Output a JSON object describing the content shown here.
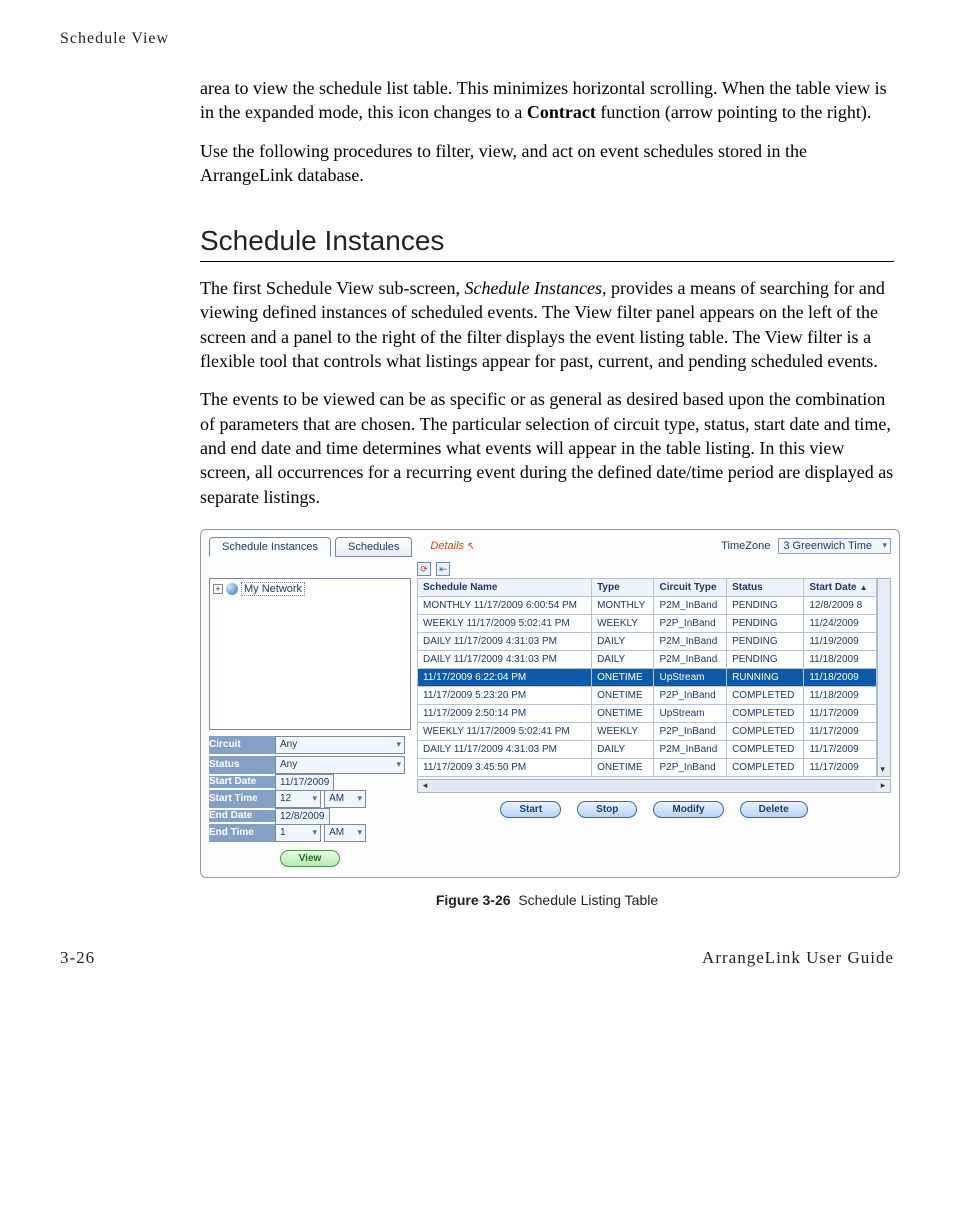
{
  "page_header": "Schedule View",
  "para1": "area to view the schedule list table. This minimizes horizontal scrolling. When the table view is in the expanded mode, this icon changes to a ",
  "para1_bold": "Contract",
  "para1_tail": " function (arrow pointing to the right).",
  "para2": "Use the following procedures to filter, view, and act on event schedules stored in the ArrangeLink database.",
  "section_heading": "Schedule Instances",
  "para3_a": "The first Schedule View sub-screen, ",
  "para3_em": "Schedule Instances",
  "para3_b": ", provides a means of searching for and viewing defined instances of scheduled events. The View filter panel appears on the left of the screen and a panel to the right of the filter displays the event listing table. The View filter is a flexible tool that controls what listings appear for past, current, and pending scheduled events.",
  "para4": "The events to be viewed can be as specific or as general as desired based upon the combination of parameters that are chosen. The particular selection of circuit type, status, start date and time, and end date and time determines what events will appear in the table listing. In this view screen, all occurrences for a recurring event during the defined date/time period are displayed as separate listings.",
  "figure_label": "Figure 3-26",
  "figure_title": "Schedule Listing Table",
  "footer_left": "3-26",
  "footer_right": "ArrangeLink User Guide",
  "app": {
    "tabs": {
      "instances": "Schedule Instances",
      "schedules": "Schedules"
    },
    "details": "Details",
    "timezone_label": "TimeZone",
    "timezone_value": "3 Greenwich Time",
    "tree_root": "My Network",
    "filters": {
      "circuit_label": "Circuit",
      "circuit_value": "Any",
      "status_label": "Status",
      "status_value": "Any",
      "startdate_label": "Start Date",
      "startdate_value": "11/17/2009",
      "starttime_label": "Start Time",
      "starttime_hour": "12",
      "starttime_ampm": "AM",
      "enddate_label": "End Date",
      "enddate_value": "12/8/2009",
      "endtime_label": "End Time",
      "endtime_hour": "1",
      "endtime_ampm": "AM"
    },
    "view_btn": "View",
    "grid_headers": {
      "name": "Schedule Name",
      "type": "Type",
      "circuit": "Circuit Type",
      "status": "Status",
      "start": "Start Date"
    },
    "rows": [
      {
        "name": "MONTHLY 11/17/2009 6:00:54 PM",
        "type": "MONTHLY",
        "circuit": "P2M_InBand",
        "status": "PENDING",
        "start": "12/8/2009 8"
      },
      {
        "name": "WEEKLY 11/17/2009 5:02:41 PM",
        "type": "WEEKLY",
        "circuit": "P2P_InBand",
        "status": "PENDING",
        "start": "11/24/2009"
      },
      {
        "name": "DAILY 11/17/2009 4:31:03 PM",
        "type": "DAILY",
        "circuit": "P2M_InBand",
        "status": "PENDING",
        "start": "11/19/2009"
      },
      {
        "name": "DAILY 11/17/2009 4:31:03 PM",
        "type": "DAILY",
        "circuit": "P2M_InBand",
        "status": "PENDING",
        "start": "11/18/2009"
      },
      {
        "name": "11/17/2009 6:22:04 PM",
        "type": "ONETIME",
        "circuit": "UpStream",
        "status": "RUNNING",
        "start": "11/18/2009",
        "running": true
      },
      {
        "name": "11/17/2009 5:23:20 PM",
        "type": "ONETIME",
        "circuit": "P2P_InBand",
        "status": "COMPLETED",
        "start": "11/18/2009"
      },
      {
        "name": "11/17/2009 2:50:14 PM",
        "type": "ONETIME",
        "circuit": "UpStream",
        "status": "COMPLETED",
        "start": "11/17/2009"
      },
      {
        "name": "WEEKLY 11/17/2009 5:02:41 PM",
        "type": "WEEKLY",
        "circuit": "P2P_InBand",
        "status": "COMPLETED",
        "start": "11/17/2009"
      },
      {
        "name": "DAILY 11/17/2009 4:31:03 PM",
        "type": "DAILY",
        "circuit": "P2M_InBand",
        "status": "COMPLETED",
        "start": "11/17/2009"
      },
      {
        "name": "11/17/2009 3:45:50 PM",
        "type": "ONETIME",
        "circuit": "P2P_InBand",
        "status": "COMPLETED",
        "start": "11/17/2009"
      }
    ],
    "buttons": {
      "start": "Start",
      "stop": "Stop",
      "modify": "Modify",
      "delete": "Delete"
    }
  }
}
